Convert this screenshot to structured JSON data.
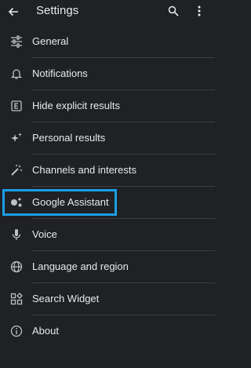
{
  "appbar": {
    "title": "Settings"
  },
  "settings_items": [
    {
      "label": "General",
      "icon": "sliders-icon"
    },
    {
      "label": "Notifications",
      "icon": "bell-icon"
    },
    {
      "label": "Hide explicit results",
      "icon": "explicit-icon"
    },
    {
      "label": "Personal results",
      "icon": "sparkle-icon"
    },
    {
      "label": "Channels and interests",
      "icon": "magic-wand-icon"
    },
    {
      "label": "Google Assistant",
      "icon": "assistant-icon"
    },
    {
      "label": "Voice",
      "icon": "microphone-icon"
    },
    {
      "label": "Language and region",
      "icon": "globe-icon"
    },
    {
      "label": "Search Widget",
      "icon": "widget-icon"
    },
    {
      "label": "About",
      "icon": "info-icon"
    }
  ],
  "colors": {
    "background": "#202124",
    "text": "#e8eaed",
    "icon": "#bdc1c6",
    "highlight": "#1a9ee6",
    "divider": "#3c4043"
  }
}
